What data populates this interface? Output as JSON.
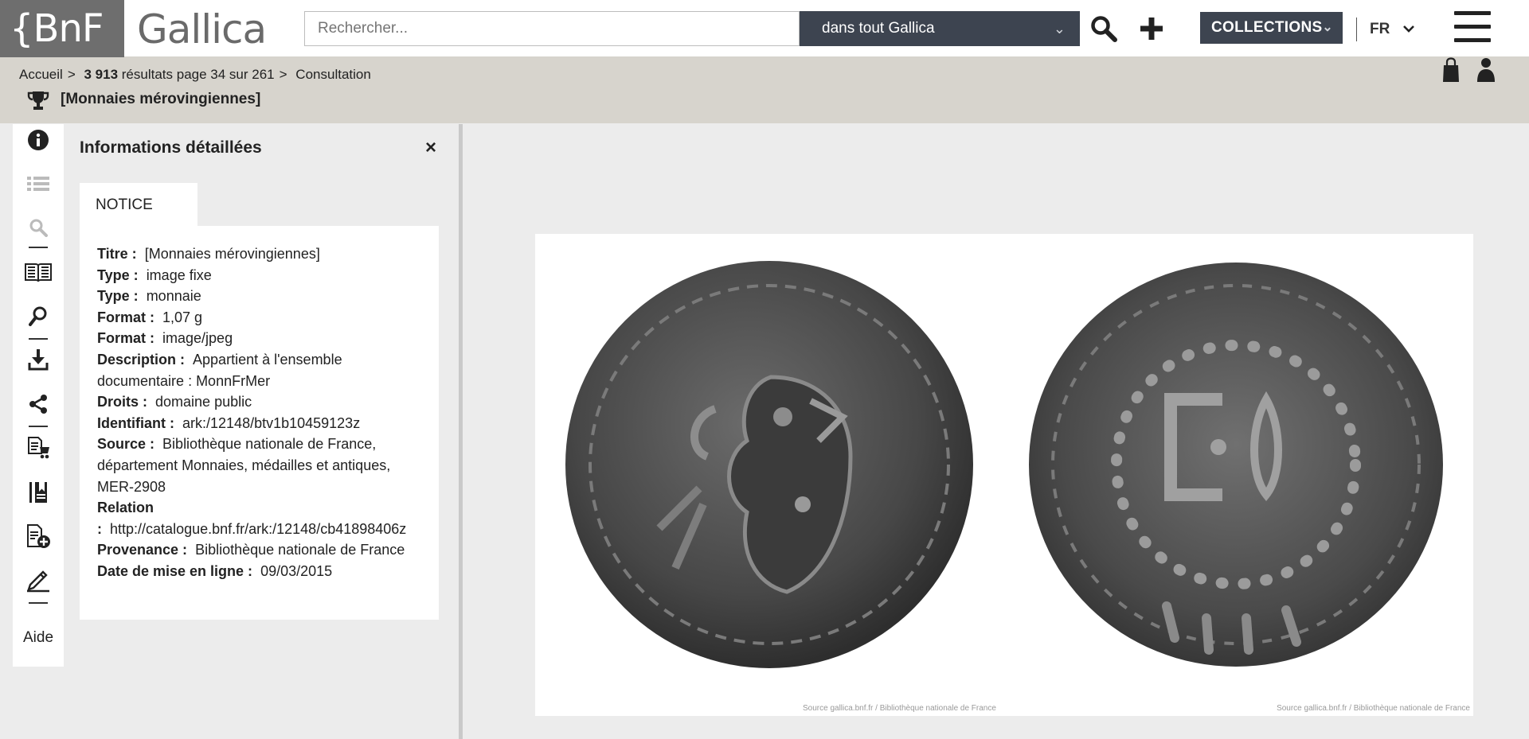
{
  "header": {
    "logo_bnf": "{BnF",
    "logo_gallica": "Gallica",
    "search_placeholder": "Rechercher...",
    "scope_label": "dans tout Gallica",
    "collections_label": "COLLECTIONS",
    "lang_label": "FR"
  },
  "breadcrumb": {
    "home": "Accueil",
    "results_count": "3 913",
    "results_text": "résultats page 34 sur 261",
    "current": "Consultation"
  },
  "document": {
    "title": "[Monnaies mérovingiennes]"
  },
  "toolbar": {
    "help_label": "Aide"
  },
  "panel": {
    "title": "Informations détaillées",
    "close": "×",
    "tab_label": "NOTICE",
    "fields": [
      {
        "key": "Titre :",
        "value": "[Monnaies mérovingiennes]"
      },
      {
        "key": "Type :",
        "value": "image fixe"
      },
      {
        "key": "Type :",
        "value": "monnaie"
      },
      {
        "key": "Format :",
        "value": "1,07 g"
      },
      {
        "key": "Format :",
        "value": "image/jpeg"
      },
      {
        "key": "Description :",
        "value": "Appartient à l'ensemble documentaire : MonnFrMer"
      },
      {
        "key": "Droits :",
        "value": "domaine public"
      },
      {
        "key": "Identifiant :",
        "value": "ark:/12148/btv1b10459123z"
      },
      {
        "key": "Source :",
        "value": "Bibliothèque nationale de France, département Monnaies, médailles et antiques, MER-2908"
      },
      {
        "key": "Relation :",
        "value": "http://catalogue.bnf.fr/ark:/12148/cb41898406z"
      },
      {
        "key": "Provenance :",
        "value": "Bibliothèque nationale de France"
      },
      {
        "key": "Date de mise en ligne :",
        "value": "09/03/2015"
      }
    ]
  },
  "viewer": {
    "credit_left": "Source gallica.bnf.fr / Bibliothèque nationale de France",
    "credit_right": "Source gallica.bnf.fr / Bibliothèque nationale de France"
  },
  "colors": {
    "dark_slate": "#3d4450",
    "crumb_bg": "#d7d4cd",
    "logo_gray": "#6e6e6e"
  }
}
